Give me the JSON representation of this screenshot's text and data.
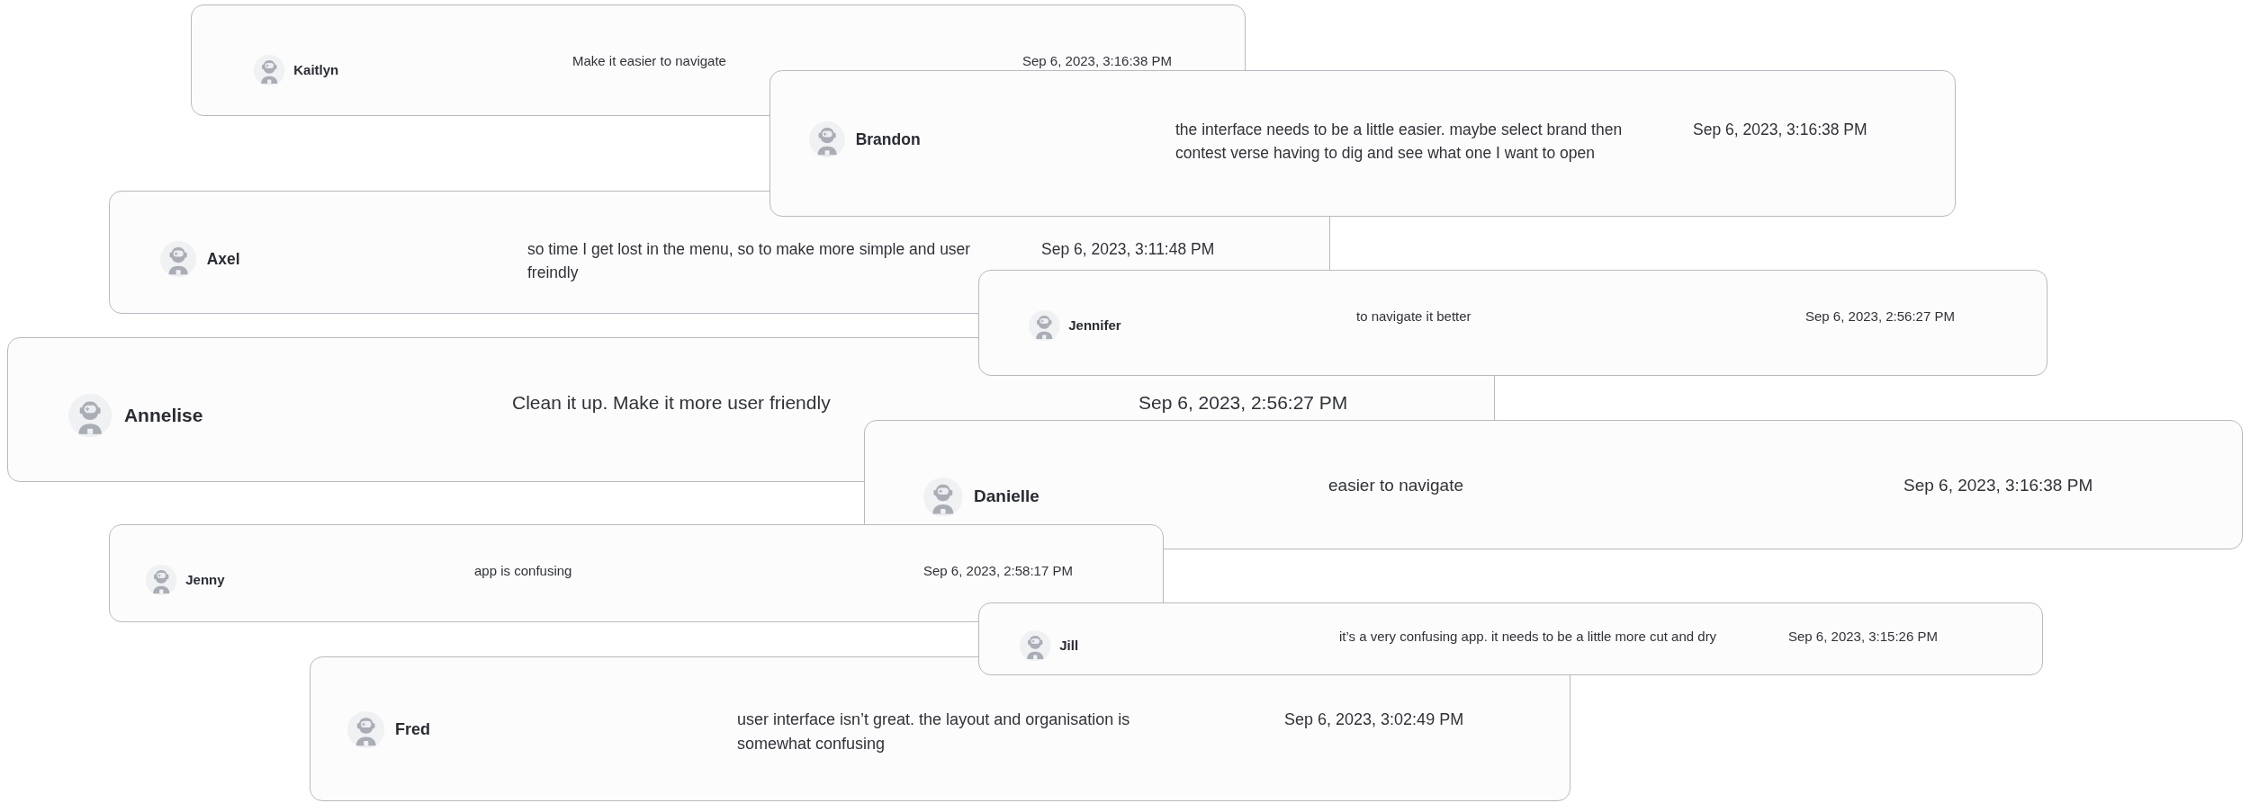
{
  "cards": [
    {
      "name": "Kaitlyn",
      "comment": "Make it easier to navigate",
      "date": "Sep 6, 2023, 3:16:38 PM"
    },
    {
      "name": "Brandon",
      "comment": "the interface needs to be a little easier. maybe select brand then contest verse having to dig and see what one I want to open",
      "date": "Sep 6, 2023, 3:16:38 PM"
    },
    {
      "name": "Axel",
      "comment": "so time I get lost in the menu, so to make more simple and user freindly",
      "date": "Sep 6, 2023, 3:11:48 PM"
    },
    {
      "name": "Jennifer",
      "comment": "to navigate it better",
      "date": "Sep 6, 2023, 2:56:27 PM"
    },
    {
      "name": "Annelise",
      "comment": "Clean it up. Make it more user friendly",
      "date": "Sep 6, 2023, 2:56:27 PM"
    },
    {
      "name": "Danielle",
      "comment": "easier to navigate",
      "date": "Sep 6, 2023, 3:16:38 PM"
    },
    {
      "name": "Jenny",
      "comment": "app is confusing",
      "date": "Sep 6, 2023, 2:58:17 PM"
    },
    {
      "name": "Jill",
      "comment": "it’s a very confusing app. it needs to be a little more cut and dry",
      "date": "Sep 6, 2023, 3:15:26 PM"
    },
    {
      "name": "Fred",
      "comment": "user interface isn’t great. the layout and organisation is somewhat confusing",
      "date": "Sep 6, 2023, 3:02:49 PM"
    }
  ]
}
